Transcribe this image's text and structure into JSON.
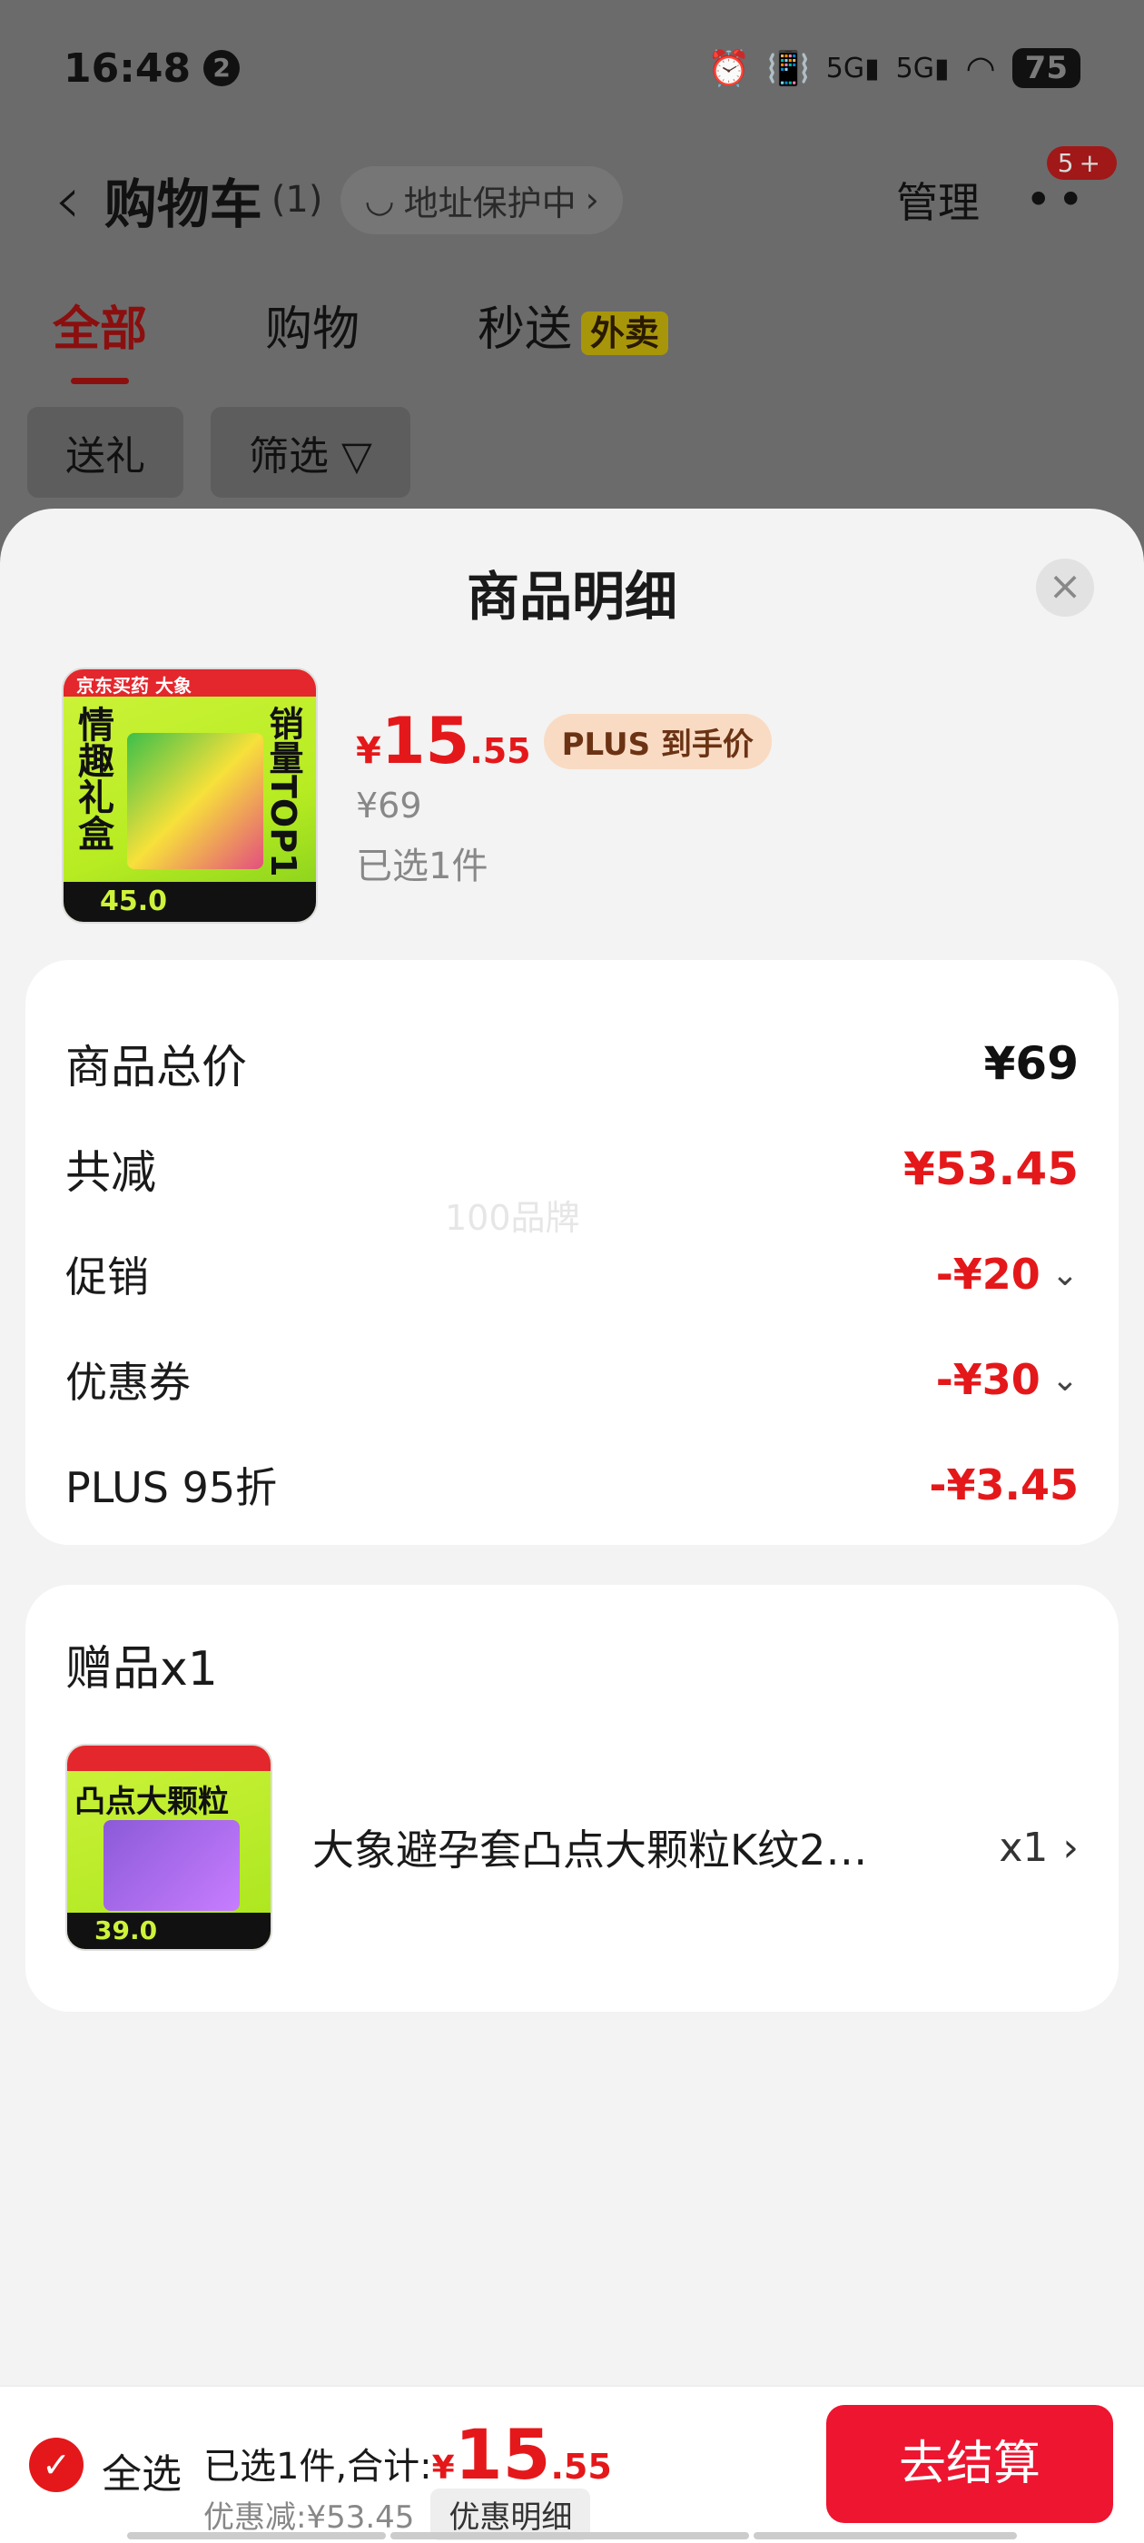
{
  "status_bar": {
    "time": "16:48",
    "notif_count": "2",
    "battery": "75",
    "signal1": "5G",
    "signal2": "5G"
  },
  "header": {
    "title": "购物车",
    "count": "(1)",
    "address": "地址保护中",
    "manage": "管理",
    "badge": "5+"
  },
  "tabs": [
    {
      "label": "全部"
    },
    {
      "label": "购物"
    },
    {
      "label": "秒送"
    }
  ],
  "tab_badge": "外卖",
  "filters": {
    "gift": "送礼",
    "filter": "筛选"
  },
  "sheet": {
    "title": "商品明细",
    "product": {
      "img_label_top": "京东买药 大象",
      "img_left": "情趣礼盒",
      "img_right": "销量TOP1",
      "img_price": "45.0",
      "currency": "¥",
      "price_int": "15",
      "price_dec": ".55",
      "plus_tag": "PLUS 到手价",
      "original_price": "¥69",
      "selected": "已选1件"
    },
    "summary": {
      "total_label": "商品总价",
      "total_value": "¥69",
      "reduce_label": "共减",
      "reduce_value": "¥53.45",
      "promo_label": "促销",
      "promo_value": "-¥20",
      "coupon_label": "优惠券",
      "coupon_value": "-¥30",
      "plus_label": "PLUS 95折",
      "plus_value": "-¥3.45",
      "watermark": "100品牌"
    },
    "gift": {
      "title": "赠品x1",
      "img_text": "凸点大颗粒",
      "img_price": "39.0",
      "name": "大象避孕套凸点大颗粒K纹2…",
      "qty": "x1"
    }
  },
  "bottom": {
    "select_all": "全选",
    "summary_text": "已选1件,合计:",
    "currency": "¥",
    "total_int": "15",
    "total_dec": ".55",
    "discount_text": "优惠减:¥53.45",
    "discount_button": "优惠明细",
    "checkout": "去结算"
  },
  "colors": {
    "accent": "#e4181a",
    "checkout": "#ee1530",
    "plus_tag_bg": "#f9dbc4"
  }
}
